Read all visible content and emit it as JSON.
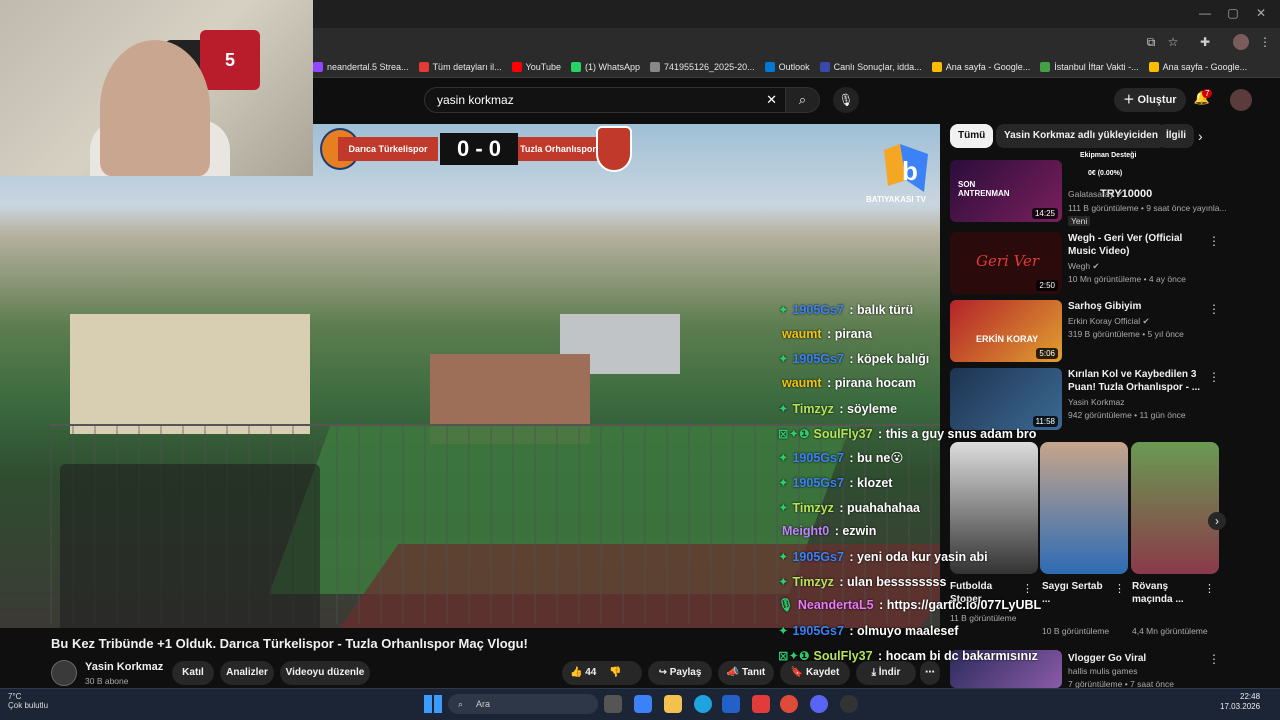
{
  "browser": {
    "url_bookmarks": [
      {
        "label": "neandertal.5 Strea...",
        "color": "#9146ff"
      },
      {
        "label": "Tüm detayları il...",
        "color": "#e53935"
      },
      {
        "label": "YouTube",
        "color": "#ff0000"
      },
      {
        "label": "(1) WhatsApp",
        "color": "#25d366"
      },
      {
        "label": "741955126_2025-20...",
        "color": "#888888"
      },
      {
        "label": "Outlook",
        "color": "#0078d4"
      },
      {
        "label": "Canlı Sonuçlar, idda...",
        "color": "#3949ab"
      },
      {
        "label": "Ana sayfa - Google...",
        "color": "#fbbc04"
      },
      {
        "label": "İstanbul İftar Vakti -...",
        "color": "#43a047"
      },
      {
        "label": "Ana sayfa - Google...",
        "color": "#fbbc04"
      }
    ]
  },
  "header": {
    "search_value": "yasin korkmaz",
    "create_label": "Oluştur",
    "notif_count": "7"
  },
  "scoreboard": {
    "team_a": "Darıca Türkelispor",
    "team_b": "Tuzla Orhanlıspor",
    "score": "0 - 0",
    "channel_logo_text": "BATIYAKASI TV"
  },
  "chat": [
    {
      "name": "1905Gs7",
      "msg": "balık türü",
      "color": "#3b82f6",
      "badge": "✦"
    },
    {
      "name": "waumt",
      "msg": "pirana",
      "color": "#f1c40f",
      "badge": ""
    },
    {
      "name": "1905Gs7",
      "msg": "köpek balığı",
      "color": "#3b82f6",
      "badge": "✦"
    },
    {
      "name": "waumt",
      "msg": "pirana hocam",
      "color": "#f1c40f",
      "badge": ""
    },
    {
      "name": "Timzyz",
      "msg": "söyleme",
      "color": "#b7e35a",
      "badge": "✦"
    },
    {
      "name": "SoulFly37",
      "msg": "this a guy snus adam bro",
      "color": "#b7e35a",
      "badge": "⊠✦❶"
    },
    {
      "name": "1905Gs7",
      "msg": "bu ne😮",
      "color": "#3b82f6",
      "badge": "✦"
    },
    {
      "name": "1905Gs7",
      "msg": "klozet",
      "color": "#3b82f6",
      "badge": "✦"
    },
    {
      "name": "Timzyz",
      "msg": "puahahahaa",
      "color": "#b7e35a",
      "badge": "✦"
    },
    {
      "name": "Meight0",
      "msg": "ezwin",
      "color": "#c084fc",
      "badge": ""
    },
    {
      "name": "1905Gs7",
      "msg": "yeni oda kur yasin abi",
      "color": "#3b82f6",
      "badge": "✦"
    },
    {
      "name": "Timzyz",
      "msg": "ulan bessssssss",
      "color": "#b7e35a",
      "badge": "✦"
    },
    {
      "name": "NeandertaL5",
      "msg": "https://gartic.io/077LyUBL",
      "color": "#e879f9",
      "badge": "🎙"
    },
    {
      "name": "1905Gs7",
      "msg": "olmuyo maalesef",
      "color": "#3b82f6",
      "badge": "✦"
    },
    {
      "name": "SoulFly37",
      "msg": "hocam bi dc bakarmısınız",
      "color": "#b7e35a",
      "badge": "⊠✦❶"
    }
  ],
  "chips": [
    "Tümü",
    "Yasin Korkmaz adlı yükleyiciden",
    "İlgili"
  ],
  "sidebar_videos": [
    {
      "title": "TRY10000",
      "channel": "Galatasaray ✔",
      "meta": "111 B görüntüleme • 9 saat önce yayınla...",
      "badge": "Yeni",
      "duration": "14:25",
      "thumb_text": "SON ANTRENMAN",
      "thumb_color": "#4a1a5c"
    },
    {
      "title": "Wegh - Geri Ver (Official Music Video)",
      "channel": "Wegh ✔",
      "meta": "10 Mn görüntüleme • 4 ay önce",
      "badge": "",
      "duration": "2:50",
      "thumb_text": "Geri Ver",
      "thumb_color": "#2a0a0a"
    },
    {
      "title": "Sarhoş Gibiyim",
      "channel": "Erkin Koray Official ✔",
      "meta": "319 B görüntüleme • 5 yıl önce",
      "badge": "",
      "duration": "5:06",
      "thumb_text": "ERKİN KORAY",
      "thumb_color": "#b4232a"
    },
    {
      "title": "Kırılan Kol ve Kaybedilen 3 Puan! Tuzla Orhanlıspor - ...",
      "channel": "Yasin Korkmaz",
      "meta": "942 görüntüleme • 11 gün önce",
      "badge": "",
      "duration": "11:58",
      "thumb_text": "",
      "thumb_color": "#2f4d6b"
    }
  ],
  "shorts": [
    {
      "title": "Futbolda Stoper ...",
      "meta": "11 B görüntüleme",
      "color": "#1e2a3a"
    },
    {
      "title": "Saygı Sertab ...",
      "meta": "10 B görüntüleme",
      "color": "#6b4a3a"
    },
    {
      "title": "Rövanş maçında ...",
      "meta": "4,4 Mn görüntüleme",
      "color": "#3a6b3a"
    }
  ],
  "bottom_video": {
    "title": "Vlogger Go Viral",
    "channel": "hallis mulis games",
    "meta": "7 görüntüleme • 7 saat önce"
  },
  "watch": {
    "title": "Bu Kez Tribünde +1 Olduk. Darıca Türkelispor - Tuzla Orhanlıspor Maç Vlogu!",
    "channel": "Yasin Korkmaz",
    "subs": "30 B abone",
    "join": "Katıl",
    "analytics": "Analizler",
    "edit": "Videoyu düzenle",
    "likes": "44",
    "share": "Paylaş",
    "promote": "Tanıt",
    "save": "Kaydet",
    "download": "İndir"
  },
  "taskbar": {
    "temp": "7°C",
    "weather": "Çok bulutlu",
    "search": "Ara",
    "time": "22:48",
    "date": "17.03.2026"
  },
  "stream_overlay": {
    "donation_label": "Ekipman Desteği",
    "donation_value": "0€ (0.00%)"
  }
}
